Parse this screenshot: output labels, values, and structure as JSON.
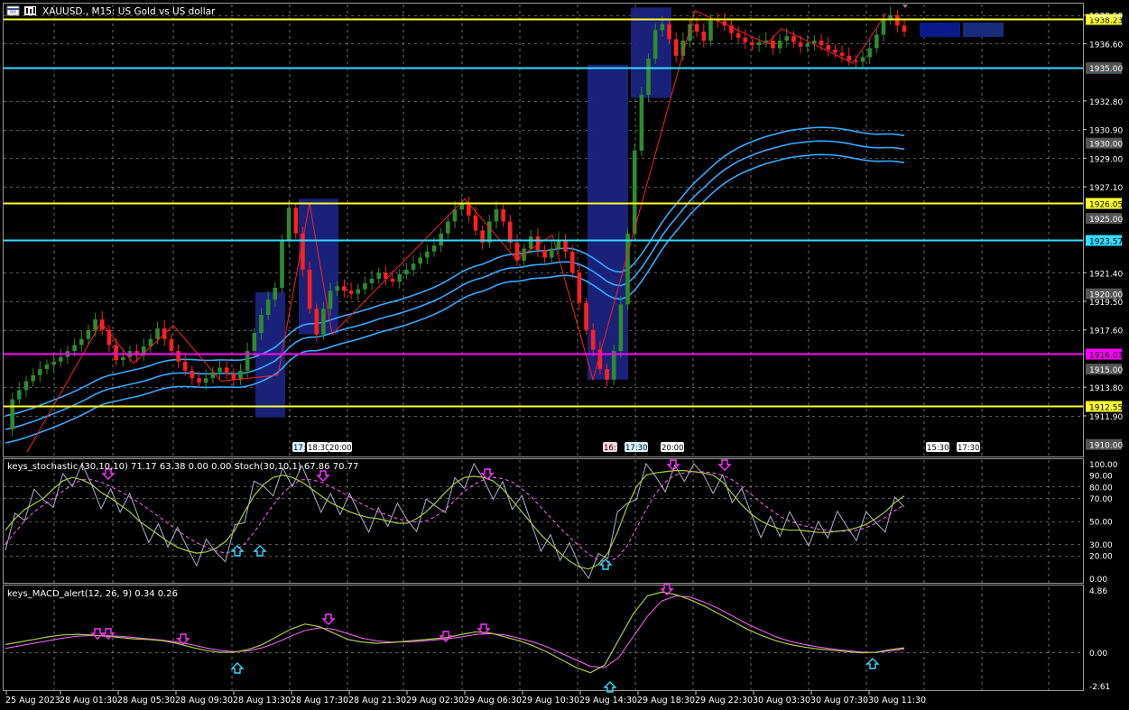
{
  "header": {
    "title": "XAUUSD., M15:  US Gold vs US dollar",
    "icons": [
      "chart-window-icon",
      "chart-type-icon"
    ]
  },
  "colors": {
    "background": "#000000",
    "grid": "#c8c8c8",
    "bull": "#2e8b2e",
    "bear": "#ff2020",
    "zigzag": "#ff2020",
    "ma": "#33aaff",
    "box": "#1a237e",
    "level_yellow": "#ffff33",
    "level_cyan": "#33ddff",
    "level_magenta": "#ff00ff",
    "stoch_main": "#aacc44",
    "stoch_signal": "#ff66ff",
    "stoch_raw": "#b0b0c8",
    "macd_main": "#aacc44",
    "macd_signal": "#ff66ff",
    "arrow_up": "#33ddff",
    "arrow_down": "#ff33ff"
  },
  "price_axis": {
    "labels": [
      "1938.50",
      "1936.60",
      "1932.80",
      "1930.90",
      "1929.00",
      "1927.10",
      "1921.40",
      "1919.50",
      "1917.60",
      "1913.80",
      "1911.90"
    ],
    "gray_tags": [
      "1935.00",
      "1930.00",
      "1925.00",
      "1920.00",
      "1915.00",
      "1910.00"
    ],
    "tag_color": "#555555"
  },
  "levels": [
    {
      "price": "1938.23",
      "color": "#ffff33"
    },
    {
      "price": "1935.00",
      "color": "#33ddff"
    },
    {
      "price": "1926.05",
      "color": "#ffff33"
    },
    {
      "price": "1923.57",
      "color": "#33ddff"
    },
    {
      "price": "1916.03",
      "color": "#ff00ff"
    },
    {
      "price": "1912.55",
      "color": "#ffff33"
    }
  ],
  "session_tags": [
    "17:",
    "18:30",
    "20:00",
    "16:1",
    "17:30",
    "20:00",
    "15:30",
    "17:30"
  ],
  "time_axis": [
    "25 Aug 2023",
    "28 Aug 01:30",
    "28 Aug 05:30",
    "28 Aug 09:30",
    "28 Aug 13:30",
    "28 Aug 17:30",
    "28 Aug 21:30",
    "29 Aug 02:30",
    "29 Aug 06:30",
    "29 Aug 10:30",
    "29 Aug 14:30",
    "29 Aug 18:30",
    "29 Aug 22:30",
    "30 Aug 03:30",
    "30 Aug 07:30",
    "30 Aug 11:30"
  ],
  "stoch_panel": {
    "title": "keys_stochastic (30,10,10) 71.17 63.38 0.00 0.00 Stoch(30,10,1) 67.86 70.77",
    "levels": [
      "100.00",
      "90.00",
      "80.00",
      "70.00",
      "50.00",
      "30.00",
      "20.00",
      "0.00"
    ]
  },
  "macd_panel": {
    "title": "keys_MACD_alert(12, 26, 9) 0.34 0.26",
    "levels": [
      "4.86",
      "0.00",
      "-2.61"
    ]
  },
  "chart_data": {
    "type": "candlestick",
    "symbol": "XAUUSD.",
    "timeframe": "M15",
    "ylim": [
      1909.2,
      1939.2
    ],
    "close_series": [
      1911.0,
      1913.0,
      1913.6,
      1914.2,
      1914.6,
      1915.0,
      1915.3,
      1915.5,
      1915.8,
      1916.2,
      1916.6,
      1917.0,
      1917.6,
      1918.3,
      1917.6,
      1916.6,
      1915.6,
      1915.8,
      1916.2,
      1915.9,
      1916.5,
      1917.0,
      1917.7,
      1917.0,
      1916.2,
      1915.5,
      1914.9,
      1914.4,
      1914.1,
      1914.4,
      1914.8,
      1915.1,
      1914.7,
      1914.3,
      1914.9,
      1916.2,
      1917.4,
      1918.6,
      1919.6,
      1920.4,
      1923.5,
      1925.7,
      1924.0,
      1921.6,
      1919.0,
      1917.3,
      1919.0,
      1920.2,
      1920.5,
      1920.2,
      1920.0,
      1920.3,
      1920.7,
      1921.0,
      1921.4,
      1921.0,
      1920.8,
      1921.3,
      1921.6,
      1922.0,
      1922.4,
      1922.8,
      1923.2,
      1924.0,
      1924.8,
      1925.6,
      1926.0,
      1925.2,
      1924.2,
      1923.4,
      1924.8,
      1925.6,
      1924.8,
      1923.4,
      1922.2,
      1923.0,
      1923.8,
      1922.9,
      1922.4,
      1923.0,
      1923.6,
      1922.8,
      1921.4,
      1919.4,
      1917.6,
      1916.3,
      1915.0,
      1914.3,
      1916.2,
      1919.3,
      1924.0,
      1929.5,
      1933.2,
      1935.6,
      1937.5,
      1937.9,
      1936.9,
      1935.8,
      1936.8,
      1937.9,
      1937.4,
      1936.8,
      1938.2,
      1938.1,
      1937.8,
      1937.3,
      1937.0,
      1936.7,
      1936.5,
      1936.7,
      1936.8,
      1936.3,
      1936.8,
      1937.1,
      1936.7,
      1936.4,
      1936.6,
      1936.8,
      1936.5,
      1936.2,
      1936.0,
      1935.8,
      1935.5,
      1935.4,
      1935.7,
      1936.3,
      1937.2,
      1938.2,
      1938.5,
      1937.8,
      1937.4
    ],
    "ma_end_values": [
      1930.5,
      1929.6,
      1928.7
    ],
    "zigzag_pivots": [
      1909.5,
      1918.1,
      1915.4,
      1917.9,
      1914.2,
      1914.6,
      1926.0,
      1917.3,
      1926.3,
      1922.3,
      1923.9,
      1914.3,
      1938.8,
      1936.6,
      1937.6,
      1935.3,
      1938.6
    ],
    "stoch_series": {
      "main": [
        42,
        52,
        60,
        65,
        70,
        78,
        85,
        88,
        86,
        82,
        75,
        70,
        64,
        58,
        50,
        44,
        38,
        32,
        27,
        24,
        22,
        23,
        26,
        32,
        42,
        58,
        72,
        82,
        88,
        90,
        88,
        84,
        78,
        72,
        66,
        62,
        58,
        55,
        53,
        52,
        50,
        48,
        48,
        52,
        58,
        66,
        75,
        83,
        88,
        89,
        88,
        85,
        78,
        68,
        58,
        48,
        38,
        30,
        22,
        15,
        10,
        8,
        12,
        22,
        40,
        62,
        80,
        90,
        92,
        93,
        94,
        94,
        93,
        92,
        90,
        84,
        74,
        64,
        56,
        50,
        46,
        43,
        42,
        42,
        41,
        40,
        40,
        41,
        42,
        44,
        47,
        52,
        58,
        66,
        72
      ],
      "signal": [
        30,
        40,
        50,
        58,
        64,
        70,
        76,
        82,
        86,
        86,
        84,
        80,
        76,
        71,
        66,
        60,
        54,
        48,
        42,
        36,
        31,
        27,
        24,
        22,
        24,
        30,
        40,
        52,
        64,
        74,
        82,
        86,
        86,
        84,
        80,
        76,
        71,
        66,
        62,
        58,
        55,
        52,
        50,
        49,
        50,
        54,
        60,
        68,
        76,
        82,
        86,
        88,
        87,
        84,
        78,
        71,
        62,
        53,
        44,
        36,
        28,
        21,
        16,
        14,
        18,
        28,
        44,
        60,
        74,
        84,
        90,
        92,
        93,
        93,
        92,
        90,
        86,
        80,
        73,
        66,
        60,
        54,
        50,
        47,
        45,
        43,
        42,
        41,
        41,
        42,
        44,
        48,
        53,
        59,
        64
      ]
    },
    "macd_series": {
      "main": [
        0.6,
        0.8,
        1.0,
        1.2,
        1.35,
        1.4,
        1.35,
        1.25,
        1.15,
        1.05,
        1.0,
        0.9,
        0.7,
        0.4,
        0.15,
        0.0,
        0.0,
        0.2,
        0.6,
        1.2,
        1.8,
        2.2,
        2.0,
        1.5,
        1.0,
        0.8,
        0.7,
        0.75,
        0.85,
        0.95,
        1.05,
        1.15,
        1.4,
        1.6,
        1.5,
        1.2,
        0.9,
        0.5,
        0.0,
        -0.6,
        -1.2,
        -1.6,
        -1.0,
        1.0,
        3.0,
        4.4,
        4.7,
        4.5,
        4.1,
        3.6,
        3.0,
        2.4,
        1.8,
        1.3,
        0.9,
        0.6,
        0.4,
        0.25,
        0.15,
        0.05,
        -0.05,
        0.0,
        0.2,
        0.34
      ],
      "signal": [
        0.3,
        0.5,
        0.7,
        0.9,
        1.1,
        1.25,
        1.3,
        1.3,
        1.25,
        1.15,
        1.05,
        0.95,
        0.8,
        0.6,
        0.35,
        0.15,
        0.05,
        0.1,
        0.35,
        0.75,
        1.25,
        1.7,
        1.9,
        1.8,
        1.45,
        1.1,
        0.9,
        0.8,
        0.8,
        0.85,
        0.95,
        1.05,
        1.2,
        1.4,
        1.45,
        1.35,
        1.1,
        0.8,
        0.4,
        -0.1,
        -0.6,
        -1.1,
        -1.2,
        -0.4,
        1.2,
        2.8,
        4.0,
        4.4,
        4.3,
        3.9,
        3.4,
        2.8,
        2.2,
        1.7,
        1.2,
        0.85,
        0.6,
        0.4,
        0.25,
        0.12,
        0.02,
        -0.02,
        0.1,
        0.26
      ]
    }
  }
}
